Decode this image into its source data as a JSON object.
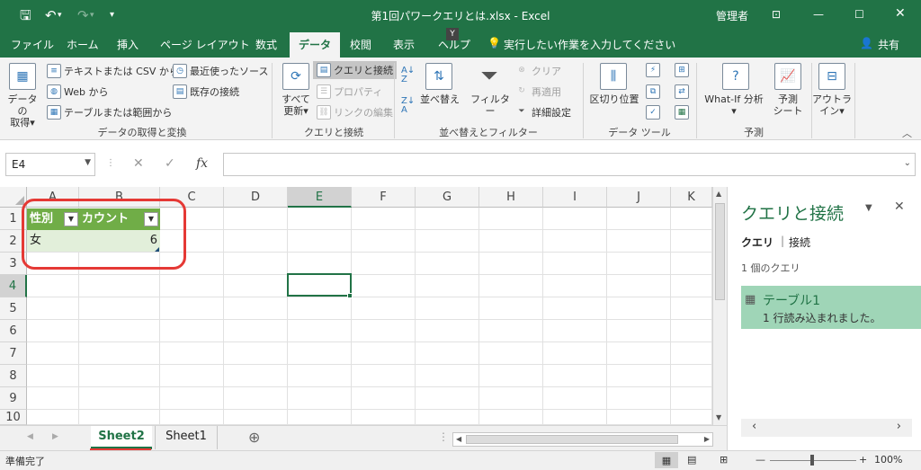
{
  "titlebar": {
    "title": "第1回パワークエリとは.xlsx  -  Excel",
    "user": "管理者",
    "save_icon": "save-icon",
    "undo_icon": "undo-icon",
    "redo_icon": "redo-icon"
  },
  "tabs": {
    "file": "ファイル",
    "home": "ホーム",
    "insert": "挿入",
    "page_layout": "ページ レイアウト",
    "formulas": "数式",
    "data": "データ",
    "review": "校閲",
    "view": "表示",
    "help": "ヘルプ",
    "tell_me": "実行したい作業を入力してください",
    "share": "共有",
    "shortcut_badge": "Y"
  },
  "ribbon": {
    "get_data_1": "データの",
    "get_data_2": "取得",
    "from_text_csv": "テキストまたは CSV から",
    "from_web": "Web から",
    "from_table": "テーブルまたは範囲から",
    "recent_sources": "最近使ったソース",
    "existing_connections": "既存の接続",
    "group_get_transform": "データの取得と変換",
    "refresh_all_1": "すべて",
    "refresh_all_2": "更新",
    "queries_connections": "クエリと接続",
    "properties": "プロパティ",
    "edit_links": "リンクの編集",
    "group_queries": "クエリと接続",
    "sort": "並べ替え",
    "filter": "フィルター",
    "clear": "クリア",
    "reapply": "再適用",
    "advanced": "詳細設定",
    "group_sort_filter": "並べ替えとフィルター",
    "text_to_columns": "区切り位置",
    "group_data_tools": "データ ツール",
    "what_if": "What-If 分析",
    "forecast_sheet_1": "予測",
    "forecast_sheet_2": "シート",
    "group_forecast": "予測",
    "outline_1": "アウトラ",
    "outline_2": "イン"
  },
  "formula_bar": {
    "name_box": "E4",
    "cancel": "✕",
    "enter": "✓",
    "fx": "fx",
    "content": ""
  },
  "grid": {
    "columns": [
      "A",
      "B",
      "C",
      "D",
      "E",
      "F",
      "G",
      "H",
      "I",
      "J",
      "K"
    ],
    "rows": [
      "1",
      "2",
      "3",
      "4",
      "5",
      "6",
      "7",
      "8",
      "9",
      "10"
    ],
    "selected_cell": "E4",
    "table": {
      "headers": [
        "性別",
        "カウント"
      ],
      "rows": [
        [
          "女",
          "6"
        ]
      ]
    }
  },
  "queries_pane": {
    "title": "クエリと接続",
    "tab_queries": "クエリ",
    "tab_connections": "接続",
    "count": "1 個のクエリ",
    "items": [
      {
        "name": "テーブル1",
        "status": "1 行読み込まれました。"
      }
    ]
  },
  "sheets": {
    "tabs": [
      "Sheet2",
      "Sheet1"
    ],
    "active": "Sheet2"
  },
  "status": {
    "ready": "準備完了",
    "zoom": "100%"
  },
  "colors": {
    "excel_green": "#217346",
    "table_header": "#70ad47",
    "table_row": "#e2efda",
    "annotation_red": "#e53935",
    "query_item": "#9fd5b7"
  }
}
